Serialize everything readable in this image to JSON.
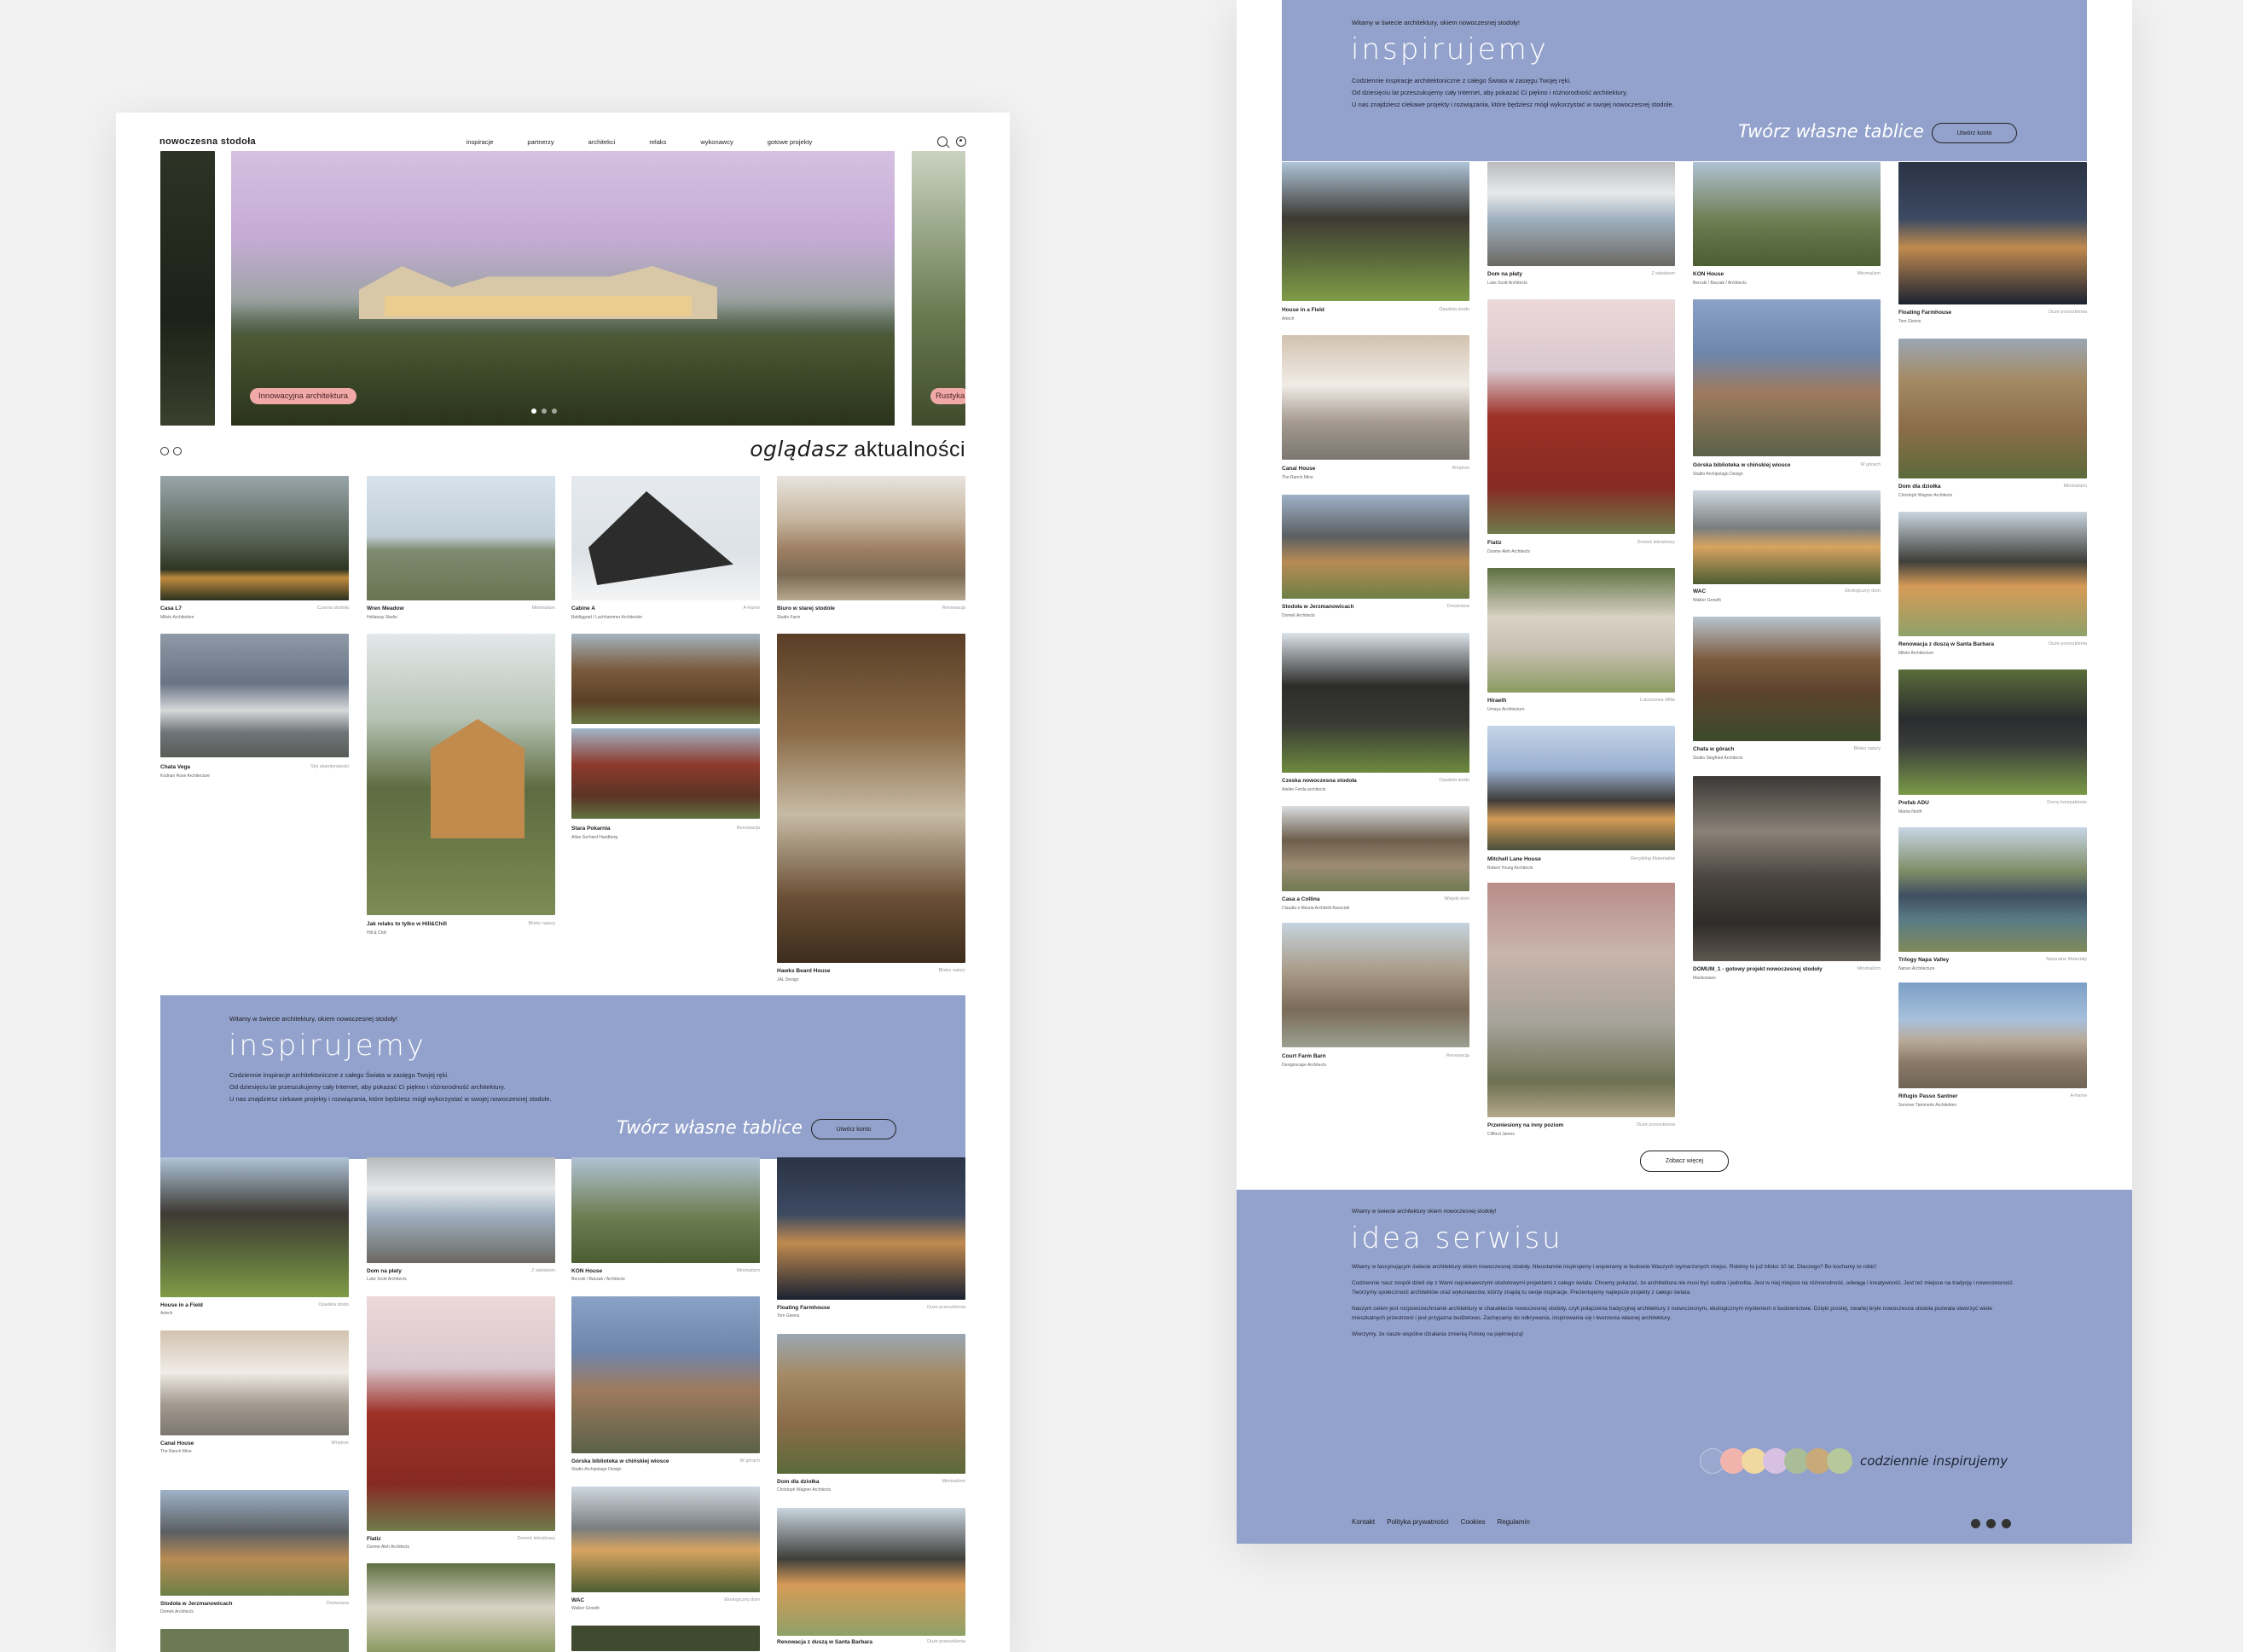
{
  "left": {
    "brand": "nowoczesna stodoła",
    "nav": [
      "inspiracje",
      "partnerzy",
      "architekci",
      "relaks",
      "wykonawcy",
      "gotowe projekty"
    ],
    "hero": {
      "tag": "Innowacyjna architektura",
      "next_tag": "Rustyka"
    },
    "heading_italic": "oglądasz",
    "heading_rest": "aktualności",
    "cards": [
      {
        "title": "Casa L7",
        "author": "Mileto Architekten",
        "tag": "Czarna stodoła"
      },
      {
        "title": "Wren Meadow",
        "author": "Hollaway Studio",
        "tag": "Minimalizm"
      },
      {
        "title": "Cabine A",
        "author": "Baldiggrad / Lachhammer Architecktn",
        "tag": "A-frame"
      },
      {
        "title": "Biuro w starej stodole",
        "author": "Studio Farm",
        "tag": "Renowacja"
      },
      {
        "title": "Chata Vega",
        "author": "Kodnan Rose Architecture",
        "tag": "Styl skandynawski"
      },
      {
        "title": "Jak relaks to tylko w Hill&Chill",
        "author": "Hill & Chill",
        "tag": "Blisko natury"
      },
      {
        "title": "Stara Pokarnia",
        "author": "Atlas Gerhard Handberg",
        "tag": "Renowacja"
      },
      {
        "title": "Hawks Beard House",
        "author": "JAL Design",
        "tag": "Blisko natury"
      }
    ]
  },
  "band": {
    "welcome": "Witamy w świecie architektury, okiem nowoczesnej stodoły!",
    "title": "inspirujemy",
    "lines": [
      "Codziennie inspiracje architektoniczne z całego Świata w zasięgu Twojej ręki.",
      "Od dziesięciu lat przeszukujemy cały Internet, aby pokazać Ci piękno i różnorodność architektury.",
      "U nas znajdziesz ciekawe projekty i rozwiązania, które będziesz mógł wykorzystać w swojej nowoczesnej stodole."
    ],
    "boards": "Twórz własne tablice",
    "button": "Utwórz konto"
  },
  "grid": [
    [
      {
        "title": "House in a Field",
        "author": "Artech",
        "tag": "Opadela stodo"
      },
      {
        "title": "Canal House",
        "author": "The Ranch Mine",
        "tag": "Wnętrze"
      },
      {
        "title": "Stodoła w Jerzmanowicach",
        "author": "Domek Architects",
        "tag": "Drewniana"
      },
      {
        "title": "Czeska nowoczesna stodoła",
        "author": "Atelier Ferda architects",
        "tag": "Opadela stodo"
      },
      {
        "title": "Casa a Collina",
        "author": "Claudia e Marzia Architetti Associati",
        "tag": "Wiejski dom"
      },
      {
        "title": "Court Farm Barn",
        "author": "Designscape Architects",
        "tag": "Renowacja"
      }
    ],
    [
      {
        "title": "Dom na płaty",
        "author": "Luke Scott Architects",
        "tag": "Z widokiem"
      },
      {
        "title": "Flatiz",
        "author": "Dzeme Aleh Architects",
        "tag": "Domek letniskowy"
      },
      {
        "title": "Hiraeth",
        "author": "Umaya Architecture",
        "tag": "Luksusowa Willa"
      },
      {
        "title": "Mitchell Lane House",
        "author": "Robert Young Architects",
        "tag": "Recykling Materiałów"
      },
      {
        "title": "Przeniesiony na inny poziom",
        "author": "Clifford James",
        "tag": "Duże przeszklenia"
      }
    ],
    [
      {
        "title": "KON House",
        "author": "Bercski / Baczak / Architects",
        "tag": "Minimalizm"
      },
      {
        "title": "Górska biblioteka w chińskiej wiosce",
        "author": "Studio Archipelago Design",
        "tag": "W górach"
      },
      {
        "title": "WAC",
        "author": "Walker Growth",
        "tag": "Ekologiczny dom"
      },
      {
        "title": "Chata w górach",
        "author": "Studio Siegfried Architects",
        "tag": "Blisko natury"
      },
      {
        "title": "DOMUM_1 - gotowy projekt nowoczesnej stodoły",
        "author": "Mankowaso",
        "tag": "Minimalizm"
      }
    ],
    [
      {
        "title": "Floating Farmhouse",
        "author": "Tom Givens",
        "tag": "Duże przeszklenia"
      },
      {
        "title": "Dom dla dziołka",
        "author": "Christoph Wagner Architects",
        "tag": "Minimalizm"
      },
      {
        "title": "Renowacja z duszą w Santa Barbara",
        "author": "Mileto Architecture",
        "tag": "Duże przeszklenia"
      },
      {
        "title": "Prefab ADU",
        "author": "Mama North",
        "tag": "Domy kompaktowe"
      },
      {
        "title": "Trilogy Napa Valley",
        "author": "Nanan Architecture",
        "tag": "Naturalne Materiały"
      },
      {
        "title": "Rifugio Passo Santner",
        "author": "Senoner Tammerle Architekten",
        "tag": "A-frame"
      }
    ]
  ],
  "see_more": "Zobacz więcej",
  "idea": {
    "welcome": "Witamy w świecie architektury okiem nowoczesnej stodoły!",
    "title": "idea serwisu",
    "paragraphs": [
      "Witamy w fascynującym świecie architektury okiem nowoczesnej stodoły. Nieustannie inspirujemy i wspieramy w budowie Waszych wymarzonych miejsc. Robimy to już blisko 10 lat. Dlaczego? Bo kochamy to robić!",
      "Codziennie nasz zespół dzieli się z Wami najciekawszymi stodołowymi projektami z całego świata. Chcemy pokazać, że architektura nie musi być nudna i jednolita. Jest w niej miejsce na różnorodność, odwagę i kreatywność. Jest też miejsce na tradycję i nowoczesność. Tworzymy społeczność architektów oraz wykonawców, którzy znajdą tu swoje inspiracje. Prezentujemy najlepsze projekty z całego świata.",
      "Naszym celem jest rozpowszechnianie architektury w charakterze nowoczesnej stodoły, czyli połączenia tradycyjnej architektury z nowoczesnym, ekologicznym myśleniem o budownictwie. Dzięki prostej, zwartej bryle nowoczesna stodoła pozwala stworzyć wiele mieszkalnych przestrzeni i jest przyjazna budżetowo. Zachęcamy do odkrywania, inspirowania się i tworzenia własnej architektury.",
      "Wierzymy, że nasze wspólne działania zmienią Polskę na piękniejszą!"
    ],
    "tagline": "codziennie inspirujemy",
    "swatches": [
      "#f0b4ad",
      "#f0d8a0",
      "#d8c0e2",
      "#a9bd99",
      "#c8a978",
      "#b7c89a"
    ],
    "footer_links": [
      "Kontakt",
      "Polityka prywatności",
      "Cookies",
      "Regulamin"
    ]
  },
  "colors": {
    "band": "#93a2cc",
    "pill": "#f1a9a7",
    "bg": "#f2f2f2"
  }
}
